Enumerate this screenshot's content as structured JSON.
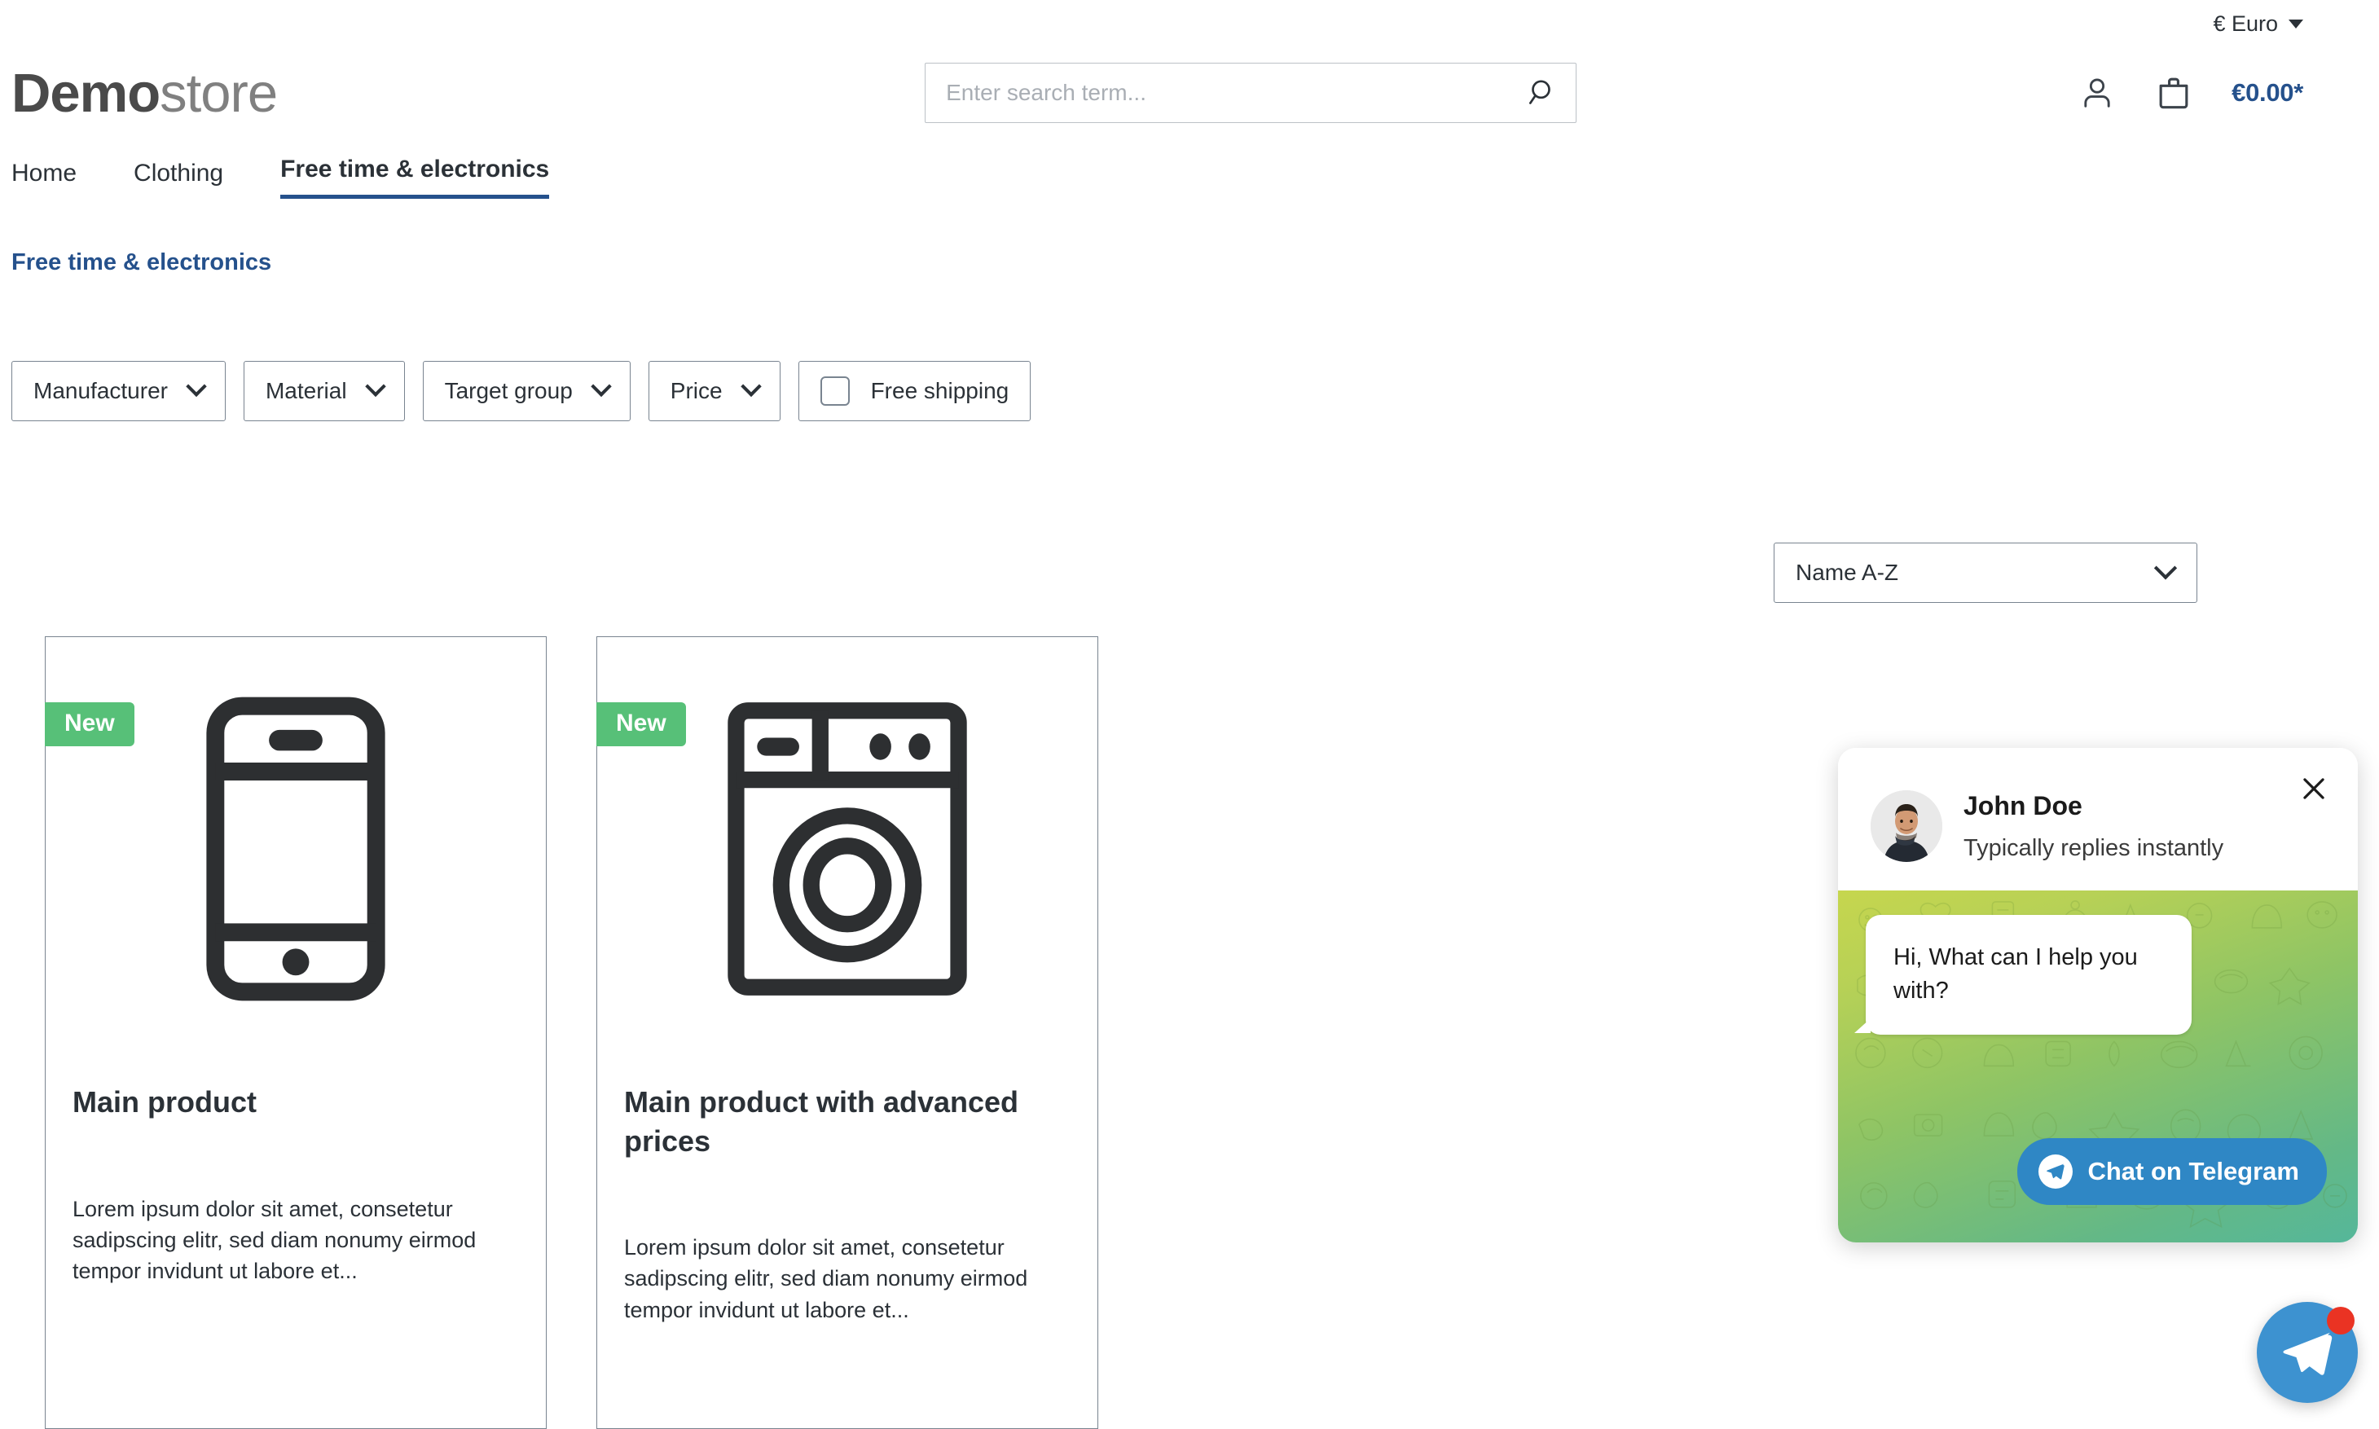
{
  "topbar": {
    "currency_label": "€ Euro",
    "currency_icon": "chevron-down-icon"
  },
  "header": {
    "logo_bold": "Demo",
    "logo_light": "store",
    "search": {
      "value": "",
      "placeholder": "Enter search term...",
      "icon": "search-icon"
    },
    "account_icon": "user-icon",
    "cart_icon": "shopping-bag-icon",
    "cart_total": "€0.00*"
  },
  "nav": {
    "items": [
      {
        "label": "Home",
        "active": false
      },
      {
        "label": "Clothing",
        "active": false
      },
      {
        "label": "Free time & electronics",
        "active": true
      }
    ]
  },
  "breadcrumb": {
    "label": "Free time & electronics"
  },
  "filters": {
    "items": [
      {
        "label": "Manufacturer",
        "icon": "chevron-down-icon"
      },
      {
        "label": "Material",
        "icon": "chevron-down-icon"
      },
      {
        "label": "Target group",
        "icon": "chevron-down-icon"
      },
      {
        "label": "Price",
        "icon": "chevron-down-icon"
      }
    ],
    "free_shipping": {
      "label": "Free shipping",
      "checked": false
    }
  },
  "sorting": {
    "selected": "Name A-Z",
    "icon": "chevron-down-icon"
  },
  "products": [
    {
      "badge": "New",
      "title": "Main product",
      "description": "Lorem ipsum dolor sit amet, consetetur sadipscing elitr, sed diam nonumy eirmod tempor invidunt ut labore et...",
      "image_icon": "smartphone-icon"
    },
    {
      "badge": "New",
      "title": "Main product with advanced prices",
      "description": "Lorem ipsum dolor sit amet, consetetur sadipscing elitr, sed diam nonumy eirmod tempor invidunt ut labore et...",
      "image_icon": "washing-machine-icon"
    }
  ],
  "chat_widget": {
    "close_icon": "close-icon",
    "avatar_icon": "agent-avatar",
    "agent_name": "John Doe",
    "agent_status": "Typically replies instantly",
    "message": "Hi, What can I help you with?",
    "cta_label": "Chat on Telegram",
    "cta_icon": "telegram-icon"
  },
  "launcher": {
    "icon": "telegram-icon",
    "has_unread_badge": true
  },
  "colors": {
    "brand_blue": "#25518c",
    "telegram_blue": "#2f87c5",
    "badge_green": "#57c078",
    "unread_red": "#ea3323",
    "border_gray": "#798490"
  }
}
